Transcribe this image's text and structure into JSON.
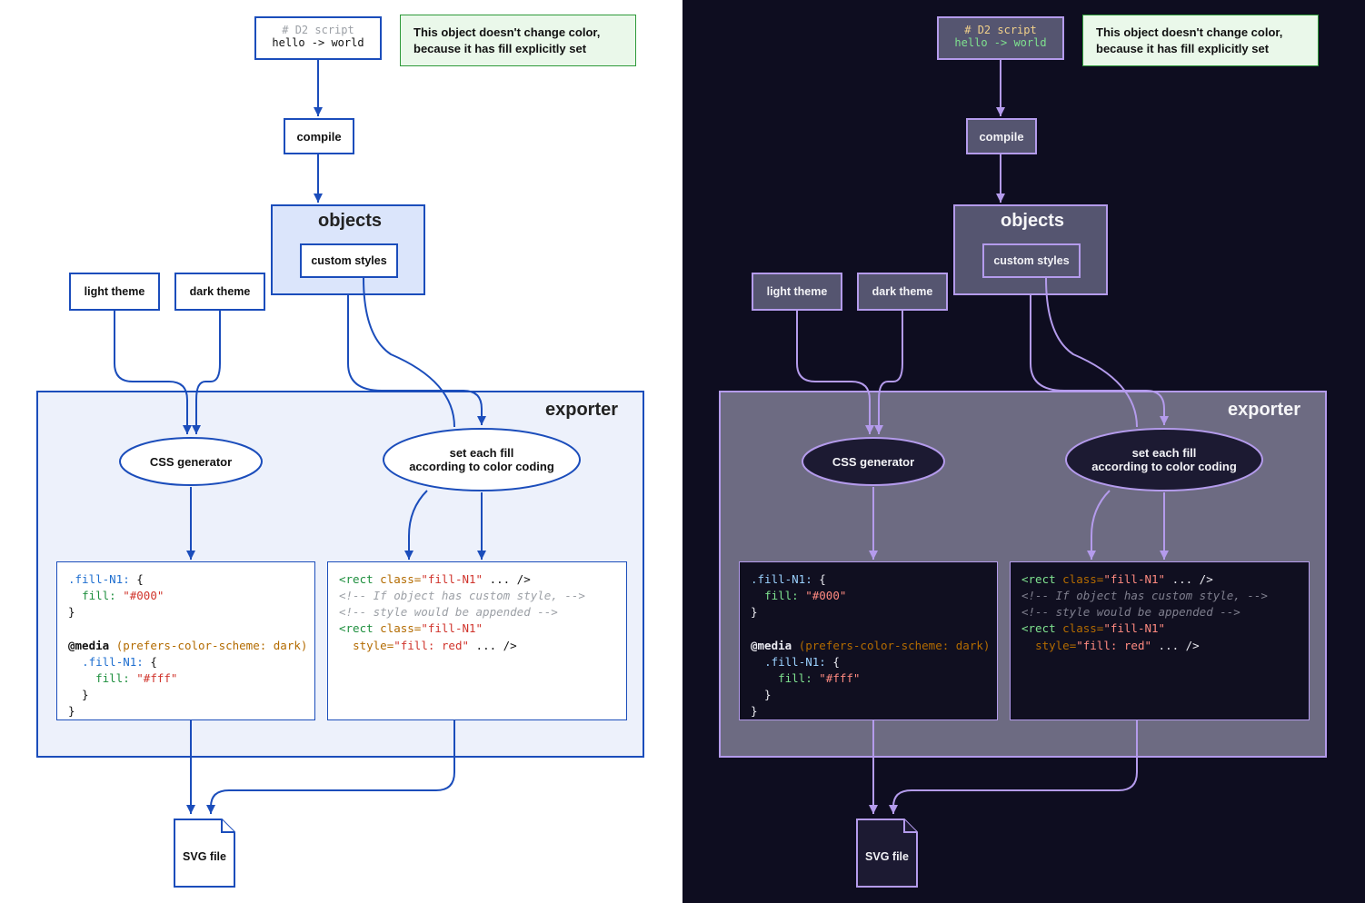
{
  "annotation": "This object doesn't change color,\nbecause it has fill explicitly set",
  "script": {
    "line1": "# D2 script",
    "line2": "hello -> world"
  },
  "compile": "compile",
  "objects": {
    "title": "objects",
    "custom": "custom styles"
  },
  "themes": {
    "light": "light theme",
    "dark": "dark theme"
  },
  "exporter": {
    "title": "exporter",
    "cssgen": "CSS generator",
    "setfill": "set each fill\naccording to color coding"
  },
  "svgfile": "SVG file",
  "code_css": {
    "l1_sel": ".fill-N1:",
    "l2_prop": "fill:",
    "l2_val": "\"#000\"",
    "l4_kw": "@media",
    "l4_cond": "(prefers-color-scheme: dark)",
    "l5_sel": ".fill-N1:",
    "l6_prop": "fill:",
    "l6_val": "\"#fff\""
  },
  "code_svg": {
    "l1_open": "<rect ",
    "l1_attr": "class=",
    "l1_val": "\"fill-N1\"",
    "l1_rest": " ... />",
    "l2": "<!-- If object has custom style, -->",
    "l3": "<!-- style would be appended -->",
    "l4_open": "<rect ",
    "l4_attr": "class=",
    "l4_val": "\"fill-N1\"",
    "l5_attr": "style=",
    "l5_val": "\"fill: red\"",
    "l5_rest": " ... />"
  }
}
